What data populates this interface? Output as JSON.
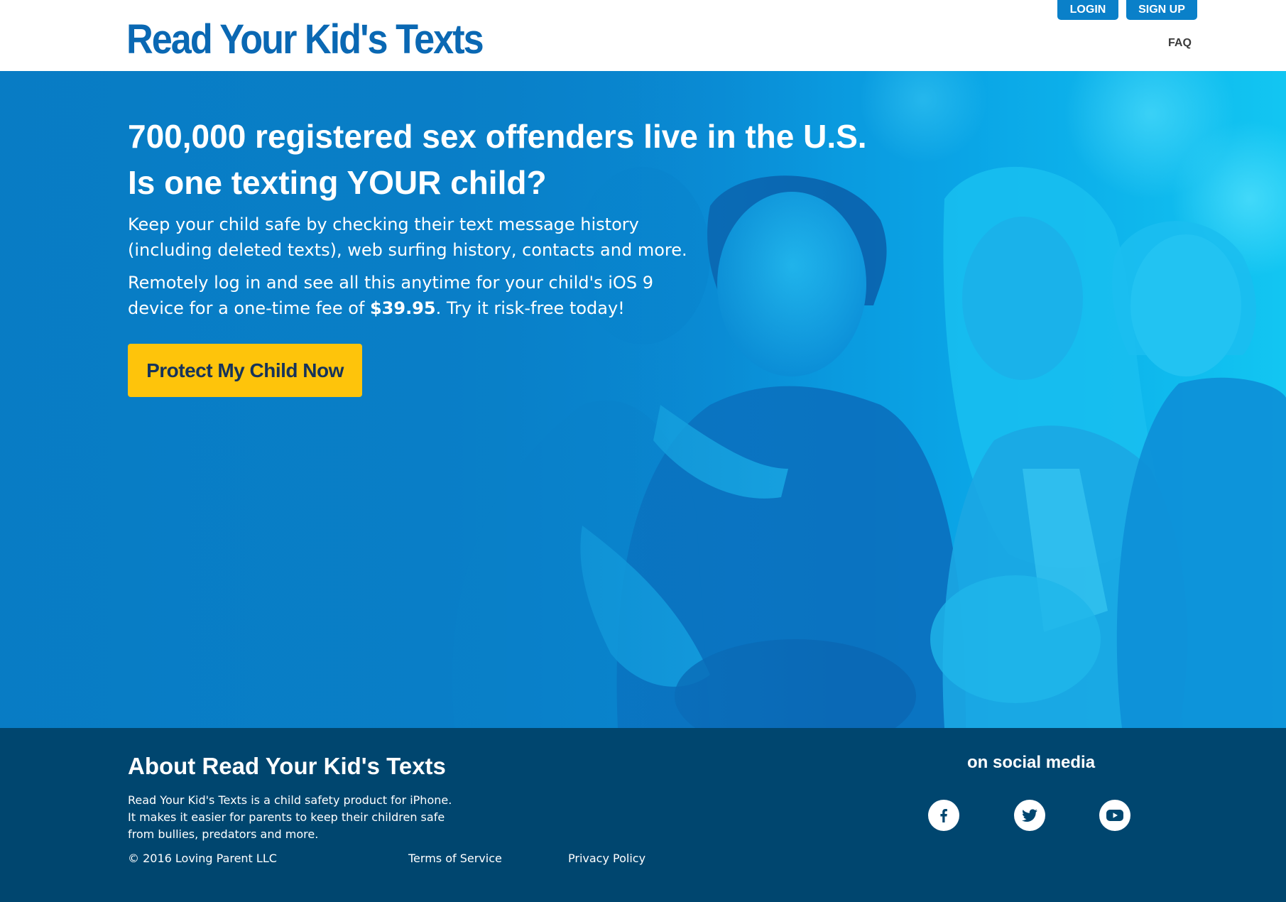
{
  "header": {
    "logo": "Read Your Kid's Texts",
    "login_label": "LOGIN",
    "signup_label": "SIGN UP",
    "faq_label": "FAQ"
  },
  "hero": {
    "title_line1": "700,000 registered sex offenders live in the U.S.",
    "title_line2": "Is one texting YOUR child?",
    "paragraph1_line1": "Keep your child safe by checking their text message history",
    "paragraph1_line2": "(including deleted texts), web surfing history, contacts and more.",
    "paragraph2_line1": "Remotely log in and see all this anytime for your child's iOS 9",
    "paragraph2_line2_before": "device for a one-time fee of ",
    "price": "$39.95",
    "paragraph2_line2_after": ". Try it risk-free today!",
    "cta_label": "Protect My Child Now"
  },
  "footer": {
    "about_title": "About Read Your Kid's Texts",
    "about_line1": "Read Your Kid's Texts is a child safety product for iPhone.",
    "about_line2": "It makes it easier for parents to keep their children safe",
    "about_line3": "from bullies, predators and more.",
    "copyright": "© 2016 Loving Parent LLC",
    "terms_label": "Terms of Service",
    "privacy_label": "Privacy Policy",
    "social_title": "on social media",
    "social_icons": [
      "facebook-icon",
      "twitter-icon",
      "youtube-icon"
    ]
  },
  "colors": {
    "brand_blue": "#0a68b3",
    "button_blue": "#0a80c9",
    "cta_yellow": "#fec40b",
    "footer_navy": "#00466f"
  }
}
